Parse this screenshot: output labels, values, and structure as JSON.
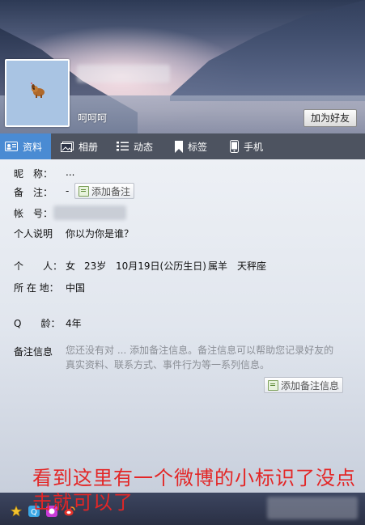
{
  "header": {
    "signature": "呵呵呵",
    "add_friend_label": "加为好友"
  },
  "tabs": [
    {
      "label": "资料",
      "icon": "profile-card-icon"
    },
    {
      "label": "相册",
      "icon": "photo-album-icon"
    },
    {
      "label": "动态",
      "icon": "feed-list-icon"
    },
    {
      "label": "标签",
      "icon": "bookmark-icon"
    },
    {
      "label": "手机",
      "icon": "phone-icon"
    }
  ],
  "profile": {
    "nickname_label": "昵　称：",
    "nickname_value": "...",
    "note_label": "备　注：",
    "note_value": "-",
    "add_note_label": "添加备注",
    "account_label": "帐　号：",
    "about_label": "个人说明",
    "about_value": "你以为你是谁？",
    "personal_label": "个　　人：",
    "personal_gender": "女",
    "personal_age": "23岁",
    "personal_birthday": "10月19日(公历生日)",
    "personal_zodiac": "属羊",
    "personal_constellation": "天秤座",
    "location_label": "所 在 地：",
    "location_value": "中国",
    "qage_label": "Q　　龄：",
    "qage_value": "4年",
    "note_info_label": "备注信息",
    "note_info_desc": "您还没有对 ... 添加备注信息。备注信息可以帮助您记录好友的真实资料、联系方式、事件行为等一系列信息。",
    "add_note_info_label": "添加备注信息"
  },
  "annotation": "看到这里有一个微博的小标识了没点击就可以了",
  "colors": {
    "active_tab": "#4a8bd3",
    "annotation": "#e32626"
  }
}
